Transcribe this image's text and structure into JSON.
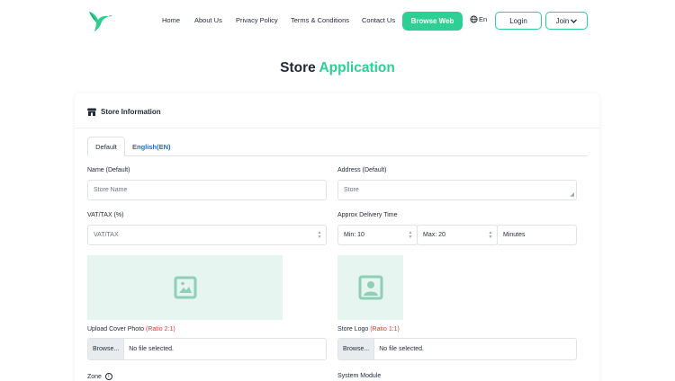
{
  "header": {
    "nav": [
      "Home",
      "About Us",
      "Privacy Policy",
      "Terms & Conditions",
      "Contact Us"
    ],
    "browse_web": "Browse Web",
    "language": "En",
    "login": "Login",
    "join": "Join"
  },
  "title": {
    "main": "Store",
    "accent": "Application"
  },
  "colors": {
    "accent": "#2ecf95",
    "link": "#1a6fd1",
    "required": "#e53935",
    "placeholder_bg": "#e6f5ef",
    "icon": "#8fcfb8"
  },
  "card": {
    "heading": "Store Information",
    "tabs": [
      "Default",
      "English(EN)"
    ],
    "name_label": "Name (Default)",
    "name_placeholder": "Store Name",
    "address_label": "Address (Default)",
    "address_placeholder": "Store",
    "vat_label": "VAT/TAX (%)",
    "vat_placeholder": "VAT/TAX",
    "delivery_label": "Approx Delivery Time",
    "delivery_min": "Min: 10",
    "delivery_max": "Max: 20",
    "delivery_unit": "Minutes",
    "cover_label": "Upload Cover Photo",
    "cover_ratio": "(Ratio 2:1)",
    "logo_label": "Store Logo",
    "logo_ratio": "(Ratio 1:1)",
    "browse": "Browse...",
    "no_file": "No file selected.",
    "zone_label": "Zone",
    "module_label": "System Module"
  }
}
